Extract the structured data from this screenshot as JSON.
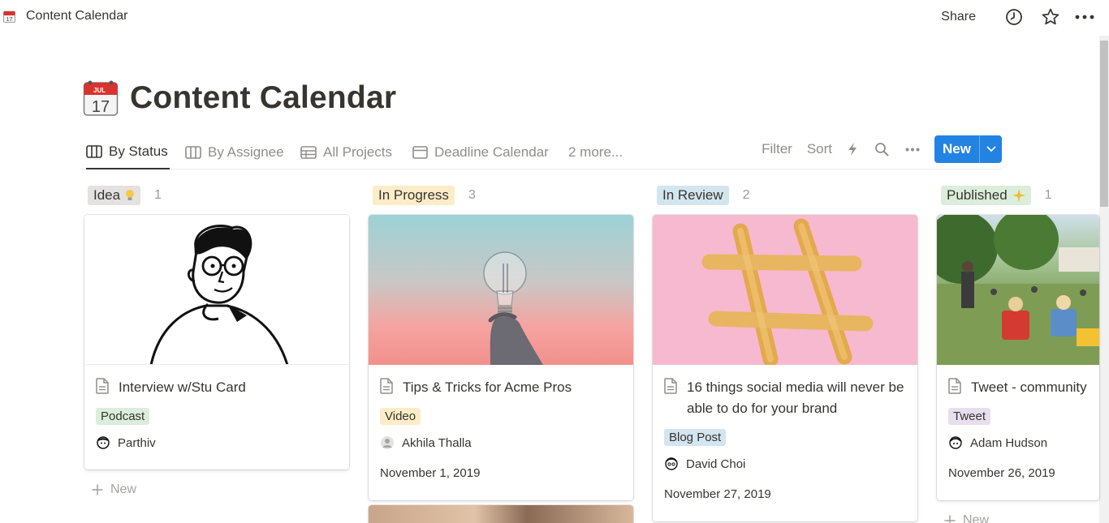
{
  "topbar": {
    "breadcrumb": "Content Calendar",
    "share_label": "Share",
    "icons": [
      "history-icon",
      "star-icon",
      "more-icon"
    ]
  },
  "page": {
    "title": "Content Calendar",
    "icon": "calendar-emoji-icon"
  },
  "views": {
    "tabs": [
      {
        "label": "By Status",
        "icon": "board-icon",
        "active": true
      },
      {
        "label": "By Assignee",
        "icon": "board-icon",
        "active": false
      },
      {
        "label": "All Projects",
        "icon": "table-icon",
        "active": false
      },
      {
        "label": "Deadline Calendar",
        "icon": "calendar-icon",
        "active": false
      }
    ],
    "more_label": "2 more...",
    "filter_label": "Filter",
    "sort_label": "Sort",
    "new_label": "New"
  },
  "colors": {
    "accent": "#2383e2",
    "idea_bg": "#e3e2e0",
    "in_progress_bg": "#fdecc8",
    "in_review_bg": "#d3e5ef",
    "published_bg": "#dbeddb",
    "tag_podcast": "#dbeddb",
    "tag_video": "#fdecc8",
    "tag_blog": "#d3e5ef",
    "tag_tweet": "#e8deee"
  },
  "board": {
    "add_new_label": "New",
    "columns": [
      {
        "status": "Idea",
        "emoji": "bulb-icon",
        "count": "1",
        "card": {
          "title": "Interview w/Stu Card",
          "tag": "Podcast",
          "person": "Parthiv",
          "date": ""
        }
      },
      {
        "status": "In Progress",
        "count": "3",
        "card": {
          "title": "Tips & Tricks for Acme Pros",
          "tag": "Video",
          "person": "Akhila Thalla",
          "date": "November 1, 2019"
        }
      },
      {
        "status": "In Review",
        "count": "2",
        "card": {
          "title": "16 things social media will never be able to do for your brand",
          "tag": "Blog Post",
          "person": "David Choi",
          "date": "November 27, 2019"
        }
      },
      {
        "status": "Published",
        "emoji": "sparkles-icon",
        "count": "1",
        "card": {
          "title": "Tweet - community",
          "tag": "Tweet",
          "person": "Adam Hudson",
          "date": "November 26, 2019"
        }
      }
    ]
  }
}
